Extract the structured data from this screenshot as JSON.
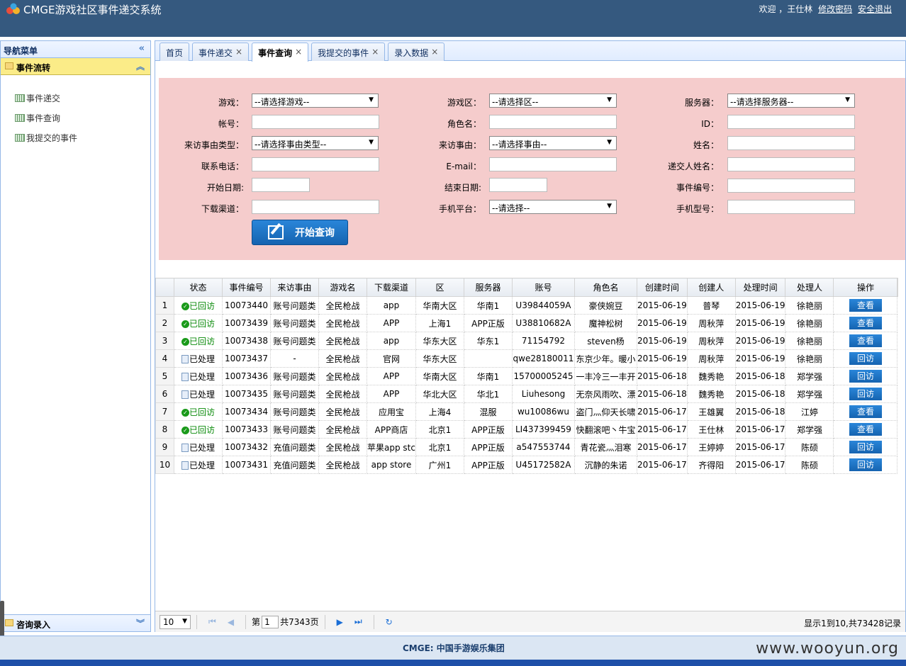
{
  "header": {
    "title": "CMGE游戏社区事件递交系统",
    "welcome": "欢迎 ，王仕林",
    "change_password": "修改密码",
    "logout": "安全退出"
  },
  "sidebar": {
    "title": "导航菜单",
    "section1": "事件流转",
    "items": [
      "事件递交",
      "事件查询",
      "我提交的事件"
    ],
    "section2": "咨询录入"
  },
  "tabs": [
    {
      "label": "首页",
      "closable": false
    },
    {
      "label": "事件递交",
      "closable": true
    },
    {
      "label": "事件查询",
      "closable": true,
      "active": true
    },
    {
      "label": "我提交的事件",
      "closable": true
    },
    {
      "label": "录入数据",
      "closable": true
    }
  ],
  "filters": {
    "game_label": "游戏：",
    "game_value": "--请选择游戏--",
    "zone_label": "游戏区：",
    "zone_value": "--请选择区--",
    "server_label": "服务器：",
    "server_value": "--请选择服务器--",
    "account_label": "帐号：",
    "role_label": "角色名：",
    "id_label": "ID：",
    "visit_type_label": "来访事由类型：",
    "visit_type_value": "--请选择事由类型--",
    "visit_reason_label": "来访事由：",
    "visit_reason_value": "--请选择事由--",
    "name_label": "姓名：",
    "phone_label": "联系电话：",
    "email_label": "E-mail：",
    "submitter_label": "递交人姓名：",
    "start_label": "开始日期:",
    "end_label": "结束日期:",
    "event_no_label": "事件编号：",
    "channel_label": "下载渠道：",
    "platform_label": "手机平台：",
    "platform_value": "--请选择--",
    "model_label": "手机型号：",
    "search_button": "开始查询"
  },
  "table": {
    "headers": [
      "状态",
      "事件编号",
      "来访事由",
      "游戏名",
      "下载渠道",
      "区",
      "服务器",
      "账号",
      "角色名",
      "创建时间",
      "创建人",
      "处理时间",
      "处理人",
      "操作"
    ],
    "rows": [
      {
        "n": "1",
        "status": "已回访",
        "done": true,
        "id": "10073440",
        "reason": "账号问题类",
        "game": "全民枪战",
        "channel": "app",
        "zone": "华南大区",
        "server": "华南1",
        "account": "U39844059A",
        "role": "豪侠婉豆",
        "ctime": "2015-06-19",
        "creator": "普琴",
        "ptime": "2015-06-19",
        "handler": "徐艳丽",
        "op": "查看"
      },
      {
        "n": "2",
        "status": "已回访",
        "done": true,
        "id": "10073439",
        "reason": "账号问题类",
        "game": "全民枪战",
        "channel": "APP",
        "zone": "上海1",
        "server": "APP正版",
        "account": "U38810682A",
        "role": "魔神松树",
        "ctime": "2015-06-19",
        "creator": "周秋萍",
        "ptime": "2015-06-19",
        "handler": "徐艳丽",
        "op": "查看"
      },
      {
        "n": "3",
        "status": "已回访",
        "done": true,
        "id": "10073438",
        "reason": "账号问题类",
        "game": "全民枪战",
        "channel": "app",
        "zone": "华东大区",
        "server": "华东1",
        "account": "71154792",
        "role": "steven杨",
        "ctime": "2015-06-19",
        "creator": "周秋萍",
        "ptime": "2015-06-19",
        "handler": "徐艳丽",
        "op": "查看"
      },
      {
        "n": "4",
        "status": "已处理",
        "done": false,
        "id": "10073437",
        "reason": "-",
        "game": "全民枪战",
        "channel": "官网",
        "zone": "华东大区",
        "server": "",
        "account": "qwe28180011",
        "role": "东京少年。暖小",
        "ctime": "2015-06-19",
        "creator": "周秋萍",
        "ptime": "2015-06-19",
        "handler": "徐艳丽",
        "op": "回访"
      },
      {
        "n": "5",
        "status": "已处理",
        "done": false,
        "id": "10073436",
        "reason": "账号问题类",
        "game": "全民枪战",
        "channel": "APP",
        "zone": "华南大区",
        "server": "华南1",
        "account": "15700005245",
        "role": "一丰冷三一丰开",
        "ctime": "2015-06-18",
        "creator": "魏秀艳",
        "ptime": "2015-06-18",
        "handler": "郑学强",
        "op": "回访"
      },
      {
        "n": "6",
        "status": "已处理",
        "done": false,
        "id": "10073435",
        "reason": "账号问题类",
        "game": "全民枪战",
        "channel": "APP",
        "zone": "华北大区",
        "server": "华北1",
        "account": "Liuhesong",
        "role": "无奈风雨吹、漂",
        "ctime": "2015-06-18",
        "creator": "魏秀艳",
        "ptime": "2015-06-18",
        "handler": "郑学强",
        "op": "回访"
      },
      {
        "n": "7",
        "status": "已回访",
        "done": true,
        "id": "10073434",
        "reason": "账号问题类",
        "game": "全民枪战",
        "channel": "应用宝",
        "zone": "上海4",
        "server": "混服",
        "account": "wu10086wu",
        "role": "盗门灬仰天长啸",
        "ctime": "2015-06-17",
        "creator": "王雄翼",
        "ptime": "2015-06-18",
        "handler": "江婷",
        "op": "查看"
      },
      {
        "n": "8",
        "status": "已回访",
        "done": true,
        "id": "10073433",
        "reason": "账号问题类",
        "game": "全民枪战",
        "channel": "APP商店",
        "zone": "北京1",
        "server": "APP正版",
        "account": "LI437399459",
        "role": "快翻滚吧丶牛宝",
        "ctime": "2015-06-17",
        "creator": "王仕林",
        "ptime": "2015-06-17",
        "handler": "郑学强",
        "op": "查看"
      },
      {
        "n": "9",
        "status": "已处理",
        "done": false,
        "id": "10073432",
        "reason": "充值问题类",
        "game": "全民枪战",
        "channel": "苹果app stc",
        "zone": "北京1",
        "server": "APP正版",
        "account": "a547553744",
        "role": "青花瓷灬泪寒",
        "ctime": "2015-06-17",
        "creator": "王婷婷",
        "ptime": "2015-06-17",
        "handler": "陈硕",
        "op": "回访"
      },
      {
        "n": "10",
        "status": "已处理",
        "done": false,
        "id": "10073431",
        "reason": "充值问题类",
        "game": "全民枪战",
        "channel": "app store",
        "zone": "广州1",
        "server": "APP正版",
        "account": "U45172582A",
        "role": "沉静的朱诺",
        "ctime": "2015-06-17",
        "creator": "齐得阳",
        "ptime": "2015-06-17",
        "handler": "陈硕",
        "op": "回访"
      }
    ]
  },
  "pager": {
    "page_size": "10",
    "page_prefix": "第",
    "page_value": "1",
    "page_total": "共7343页",
    "info": "显示1到10,共73428记录"
  },
  "footer": {
    "company": "CMGE: 中国手游娱乐集团",
    "watermark": "www.wooyun.org"
  }
}
